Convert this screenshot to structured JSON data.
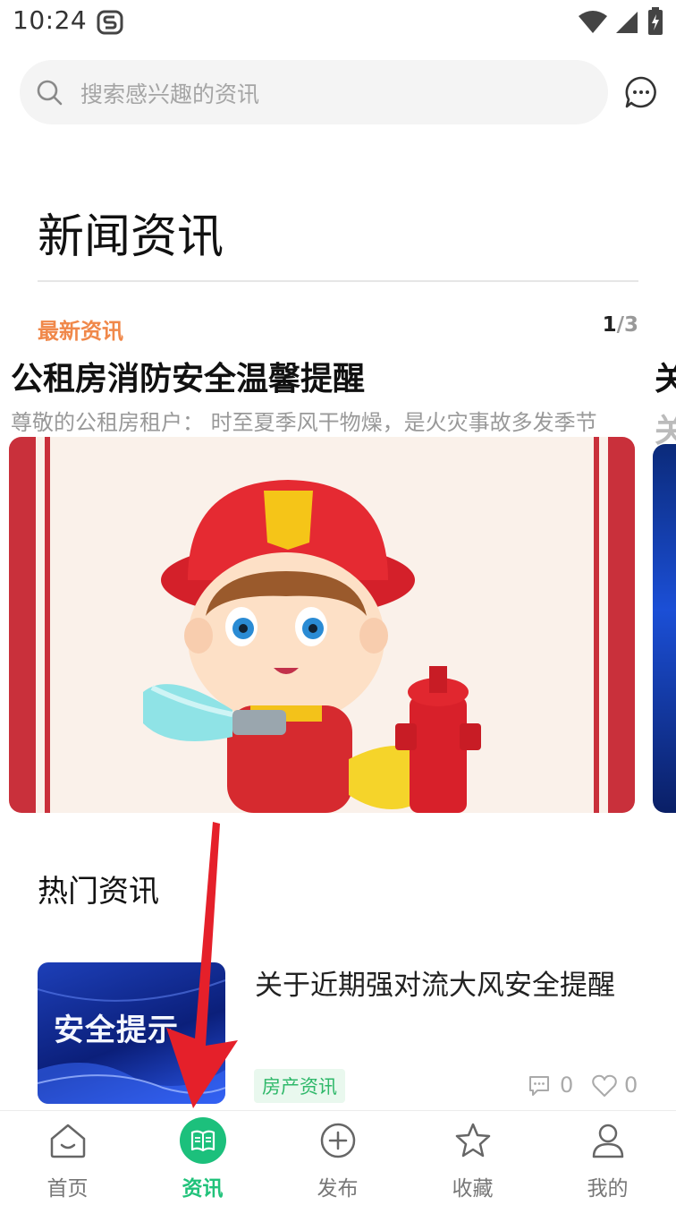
{
  "status_bar": {
    "time": "10:24"
  },
  "search": {
    "placeholder": "搜索感兴趣的资讯"
  },
  "page": {
    "title": "新闻资讯"
  },
  "carousel": {
    "label": "最新资讯",
    "pager_current": "1",
    "pager_sep": "/",
    "pager_total": "3",
    "slide_title": "公租房消防安全温馨提醒",
    "slide_summary": "尊敬的公租房租户：  时至夏季风干物燥，是火灾事故多发季节",
    "next_title": "关",
    "next_summary": "关"
  },
  "hot": {
    "title": "热门资讯",
    "items": [
      {
        "thumb_text": "安全提示",
        "title": "关于近期强对流大风安全提醒",
        "tag": "房产资讯",
        "comments": "0",
        "likes": "0"
      }
    ]
  },
  "tabs": [
    {
      "label": "首页",
      "icon": "home-icon"
    },
    {
      "label": "资讯",
      "icon": "book-icon",
      "active": true
    },
    {
      "label": "发布",
      "icon": "plus-circle-icon"
    },
    {
      "label": "收藏",
      "icon": "star-icon"
    },
    {
      "label": "我的",
      "icon": "user-icon"
    }
  ],
  "colors": {
    "accent_green": "#1cc07c",
    "latest_orange": "#f0884a",
    "arrow_red": "#e5202a"
  }
}
